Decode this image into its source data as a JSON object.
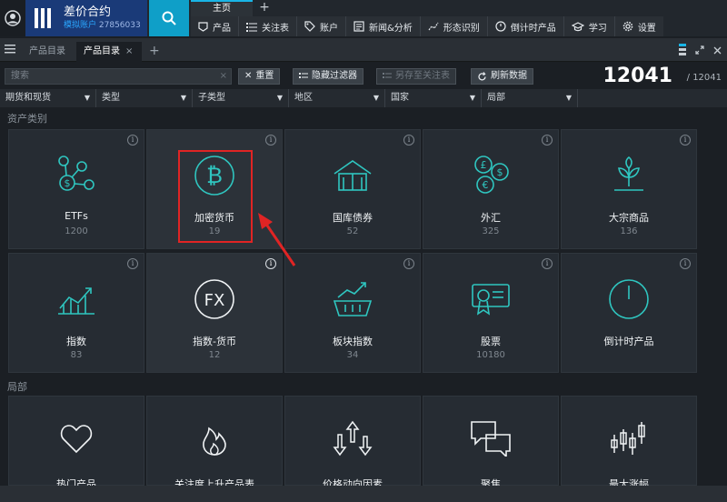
{
  "header": {
    "app_title": "差价合约",
    "account_label": "模拟账户",
    "account_number": "27856033",
    "home_tab": "主页",
    "plus_tab": "+"
  },
  "nav": [
    {
      "label": "产品",
      "icon": "product-icon"
    },
    {
      "label": "关注表",
      "icon": "watchlist-icon"
    },
    {
      "label": "账户",
      "icon": "tag-icon"
    },
    {
      "label": "新闻&分析",
      "icon": "news-icon"
    },
    {
      "label": "形态识别",
      "icon": "pattern-icon"
    },
    {
      "label": "倒计时产品",
      "icon": "clock-icon"
    },
    {
      "label": "学习",
      "icon": "graduation-icon"
    },
    {
      "label": "设置",
      "icon": "gear-icon"
    }
  ],
  "tabs": {
    "inactive": "产品目录",
    "active": "产品目录",
    "close": "×",
    "add": "+"
  },
  "filterbar": {
    "search_placeholder": "搜索",
    "reset": "重置",
    "hide_filters": "隐藏过滤器",
    "save_watchlist": "另存至关注表",
    "refresh": "刷新数据",
    "count_main": "12041",
    "count_sub": "/ 12041"
  },
  "columns": [
    "期货和现货",
    "类型",
    "子类型",
    "地区",
    "国家",
    "局部"
  ],
  "sections": {
    "asset_classes": "资产类别",
    "local": "局部"
  },
  "cards_row1": [
    {
      "label": "ETFs",
      "count": "1200",
      "icon": "etf-icon"
    },
    {
      "label": "加密货币",
      "count": "19",
      "icon": "bitcoin-icon"
    },
    {
      "label": "国库债券",
      "count": "52",
      "icon": "treasury-icon"
    },
    {
      "label": "外汇",
      "count": "325",
      "icon": "forex-icon"
    },
    {
      "label": "大宗商品",
      "count": "136",
      "icon": "commodity-icon"
    }
  ],
  "cards_row2": [
    {
      "label": "指数",
      "count": "83",
      "icon": "index-icon"
    },
    {
      "label": "指数-货币",
      "count": "12",
      "icon": "fx-icon",
      "fx_text": "FX"
    },
    {
      "label": "板块指数",
      "count": "34",
      "icon": "sector-basket-icon"
    },
    {
      "label": "股票",
      "count": "10180",
      "icon": "stock-certificate-icon"
    },
    {
      "label": "倒计时产品",
      "count": "",
      "icon": "countdown-icon"
    }
  ],
  "cards_row3": [
    {
      "label": "热门产品",
      "icon": "heart-icon"
    },
    {
      "label": "关注度上升产品表",
      "icon": "flame-icon"
    },
    {
      "label": "价格动向因素",
      "icon": "price-movement-icon"
    },
    {
      "label": "聚焦",
      "icon": "chat-bubbles-icon"
    },
    {
      "label": "最大涨幅",
      "icon": "candlestick-icon"
    }
  ],
  "colors": {
    "accent_teal": "#2fc6c0",
    "brand_blue": "#1a3a78",
    "search_blue": "#0f9fc8",
    "highlight_red": "#e02424"
  }
}
